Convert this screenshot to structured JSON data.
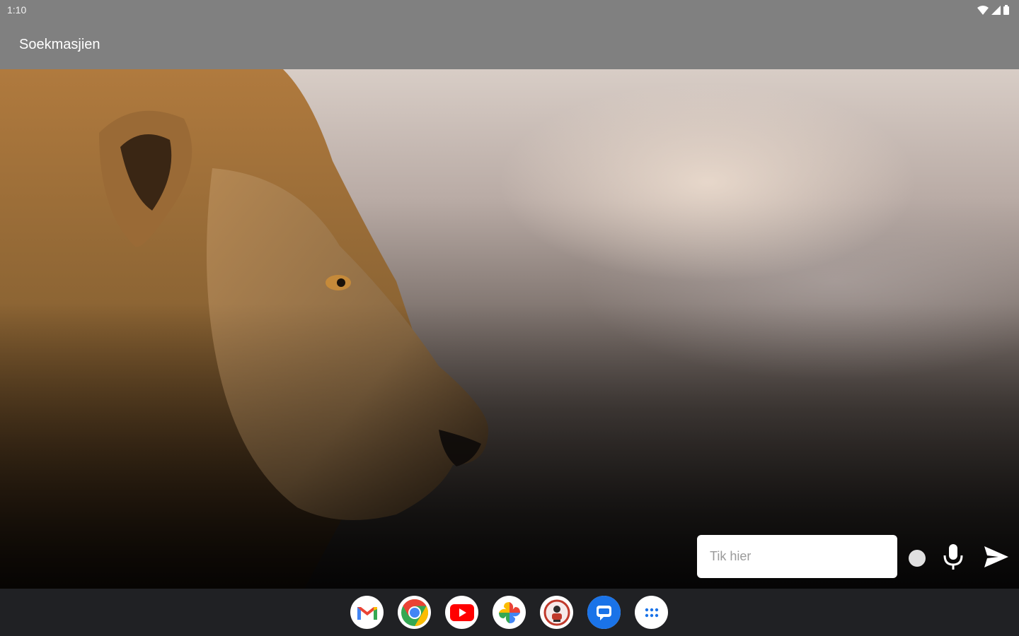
{
  "status_bar": {
    "time": "1:10",
    "icons": [
      "wifi-icon",
      "signal-icon",
      "battery-icon"
    ]
  },
  "app_bar": {
    "title": "Soekmasjien"
  },
  "search_box": {
    "placeholder": "Tik hier",
    "value": ""
  },
  "actions": {
    "record": "record-dot-icon",
    "mic": "microphone-icon",
    "send": "send-icon"
  },
  "dock": {
    "apps": [
      "gmail-icon",
      "chrome-icon",
      "youtube-icon",
      "photos-icon",
      "app-badge-icon",
      "messages-icon",
      "app-drawer-icon"
    ]
  },
  "colors": {
    "bar": "#808080",
    "dock": "#202124",
    "field": "#ffffff"
  }
}
